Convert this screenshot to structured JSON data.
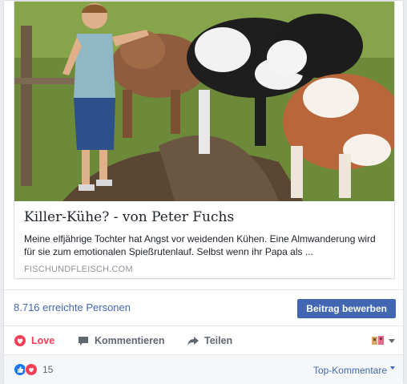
{
  "link_preview": {
    "title": "Killer-Kühe? - von Peter Fuchs",
    "description": "Meine elfjährige Tochter hat Angst vor weidenden Kühen. Eine Almwanderung wird für sie zum emotionalen Spießrutenlauf. Selbst wenn ihr Papa als ...",
    "domain": "FISCHUNDFLEISCH.COM",
    "image_icon": "boy-with-cows-photo"
  },
  "boost": {
    "reach_text": "8.716 erreichte Personen",
    "button_label": "Beitrag bewerben"
  },
  "actions": {
    "love_label": "Love",
    "comment_label": "Kommentieren",
    "share_label": "Teilen"
  },
  "reactions": {
    "count": "15",
    "icons": [
      "like-reaction-icon",
      "love-reaction-icon"
    ],
    "sort_label": "Top-Kommentare"
  },
  "colors": {
    "accent": "#4267b2",
    "love": "#f33e58",
    "muted": "#606770"
  }
}
